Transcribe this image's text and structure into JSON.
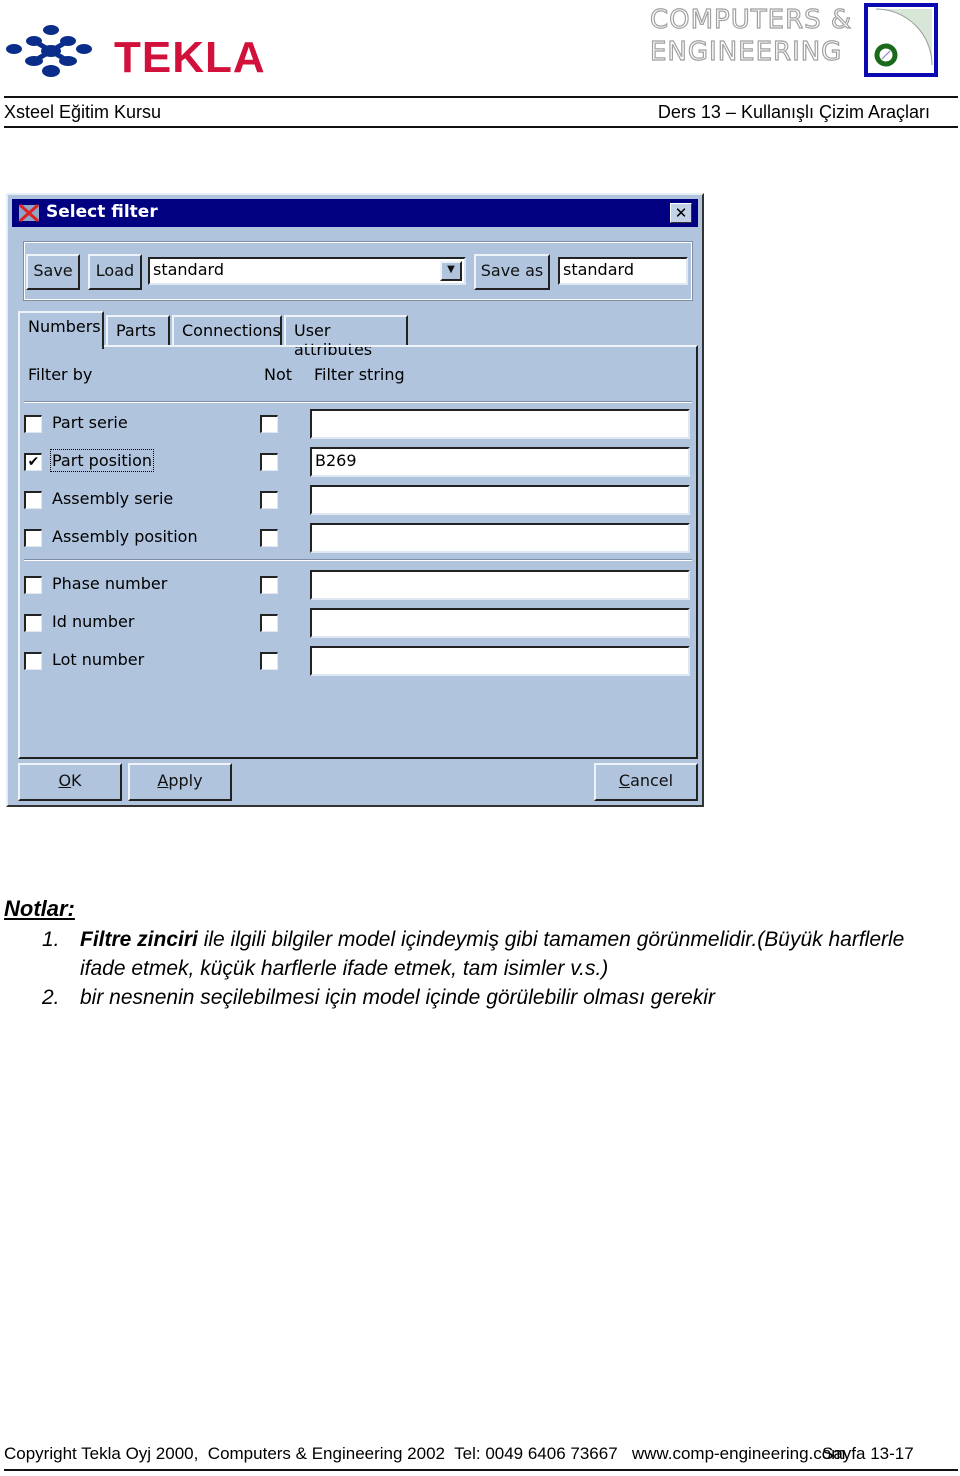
{
  "header": {
    "brand_left": "TEKLA",
    "brand_right_line1": "COMPUTERS &",
    "brand_right_line2": "ENGINEERING",
    "course_title": "Xsteel Eğitim Kursu",
    "lesson_title": "Ders 13  – Kullanışlı Çizim Araçları"
  },
  "dialog": {
    "title": "Select filter",
    "close_icon": "close-icon",
    "toolbar": {
      "save_label": "Save",
      "load_label": "Load",
      "load_select_value": "standard",
      "save_as_label": "Save as",
      "save_as_value": "standard"
    },
    "tabs": [
      {
        "label": "Numbers",
        "active": true
      },
      {
        "label": "Parts",
        "active": false
      },
      {
        "label": "Connections",
        "active": false
      },
      {
        "label": "User attributes",
        "active": false
      }
    ],
    "columns": {
      "filter_by": "Filter by",
      "not": "Not",
      "filter_string": "Filter string"
    },
    "rows": [
      {
        "label": "Part serie",
        "checked": false,
        "not": false,
        "value": ""
      },
      {
        "label": "Part position",
        "checked": true,
        "not": false,
        "value": "B269"
      },
      {
        "label": "Assembly serie",
        "checked": false,
        "not": false,
        "value": ""
      },
      {
        "label": "Assembly position",
        "checked": false,
        "not": false,
        "value": ""
      },
      {
        "label": "Phase number",
        "checked": false,
        "not": false,
        "value": ""
      },
      {
        "label": "Id number",
        "checked": false,
        "not": false,
        "value": ""
      },
      {
        "label": "Lot number",
        "checked": false,
        "not": false,
        "value": ""
      }
    ],
    "buttons": {
      "ok_accel": "O",
      "ok_rest": "K",
      "apply_accel": "A",
      "apply_rest": "pply",
      "cancel_accel": "C",
      "cancel_rest": "ancel"
    }
  },
  "notes": {
    "title": "Notlar:",
    "items": [
      {
        "number": "1.",
        "bold": "Filtre zinciri",
        "text": " ile ilgili bilgiler model içindeymiş gibi tamamen görünmelidir.(Büyük harflerle ifade etmek, küçük harflerle ifade etmek, tam isimler v.s.)"
      },
      {
        "number": "2.",
        "bold": "",
        "text": "bir nesnenin seçilebilmesi için model içinde görülebilir olması gerekir"
      }
    ]
  },
  "footer": {
    "text": "Copyright Tekla Oyj 2000,  Computers & Engineering 2002  Tel: 0049 6406 73667   www.comp-engineering.com",
    "page": "Sayfa 13-17"
  },
  "colors": {
    "tekla_red": "#d1103b",
    "tekla_blue": "#0b2d8a",
    "titlebar": "#000080",
    "dialog_bg": "#b0c4de"
  }
}
